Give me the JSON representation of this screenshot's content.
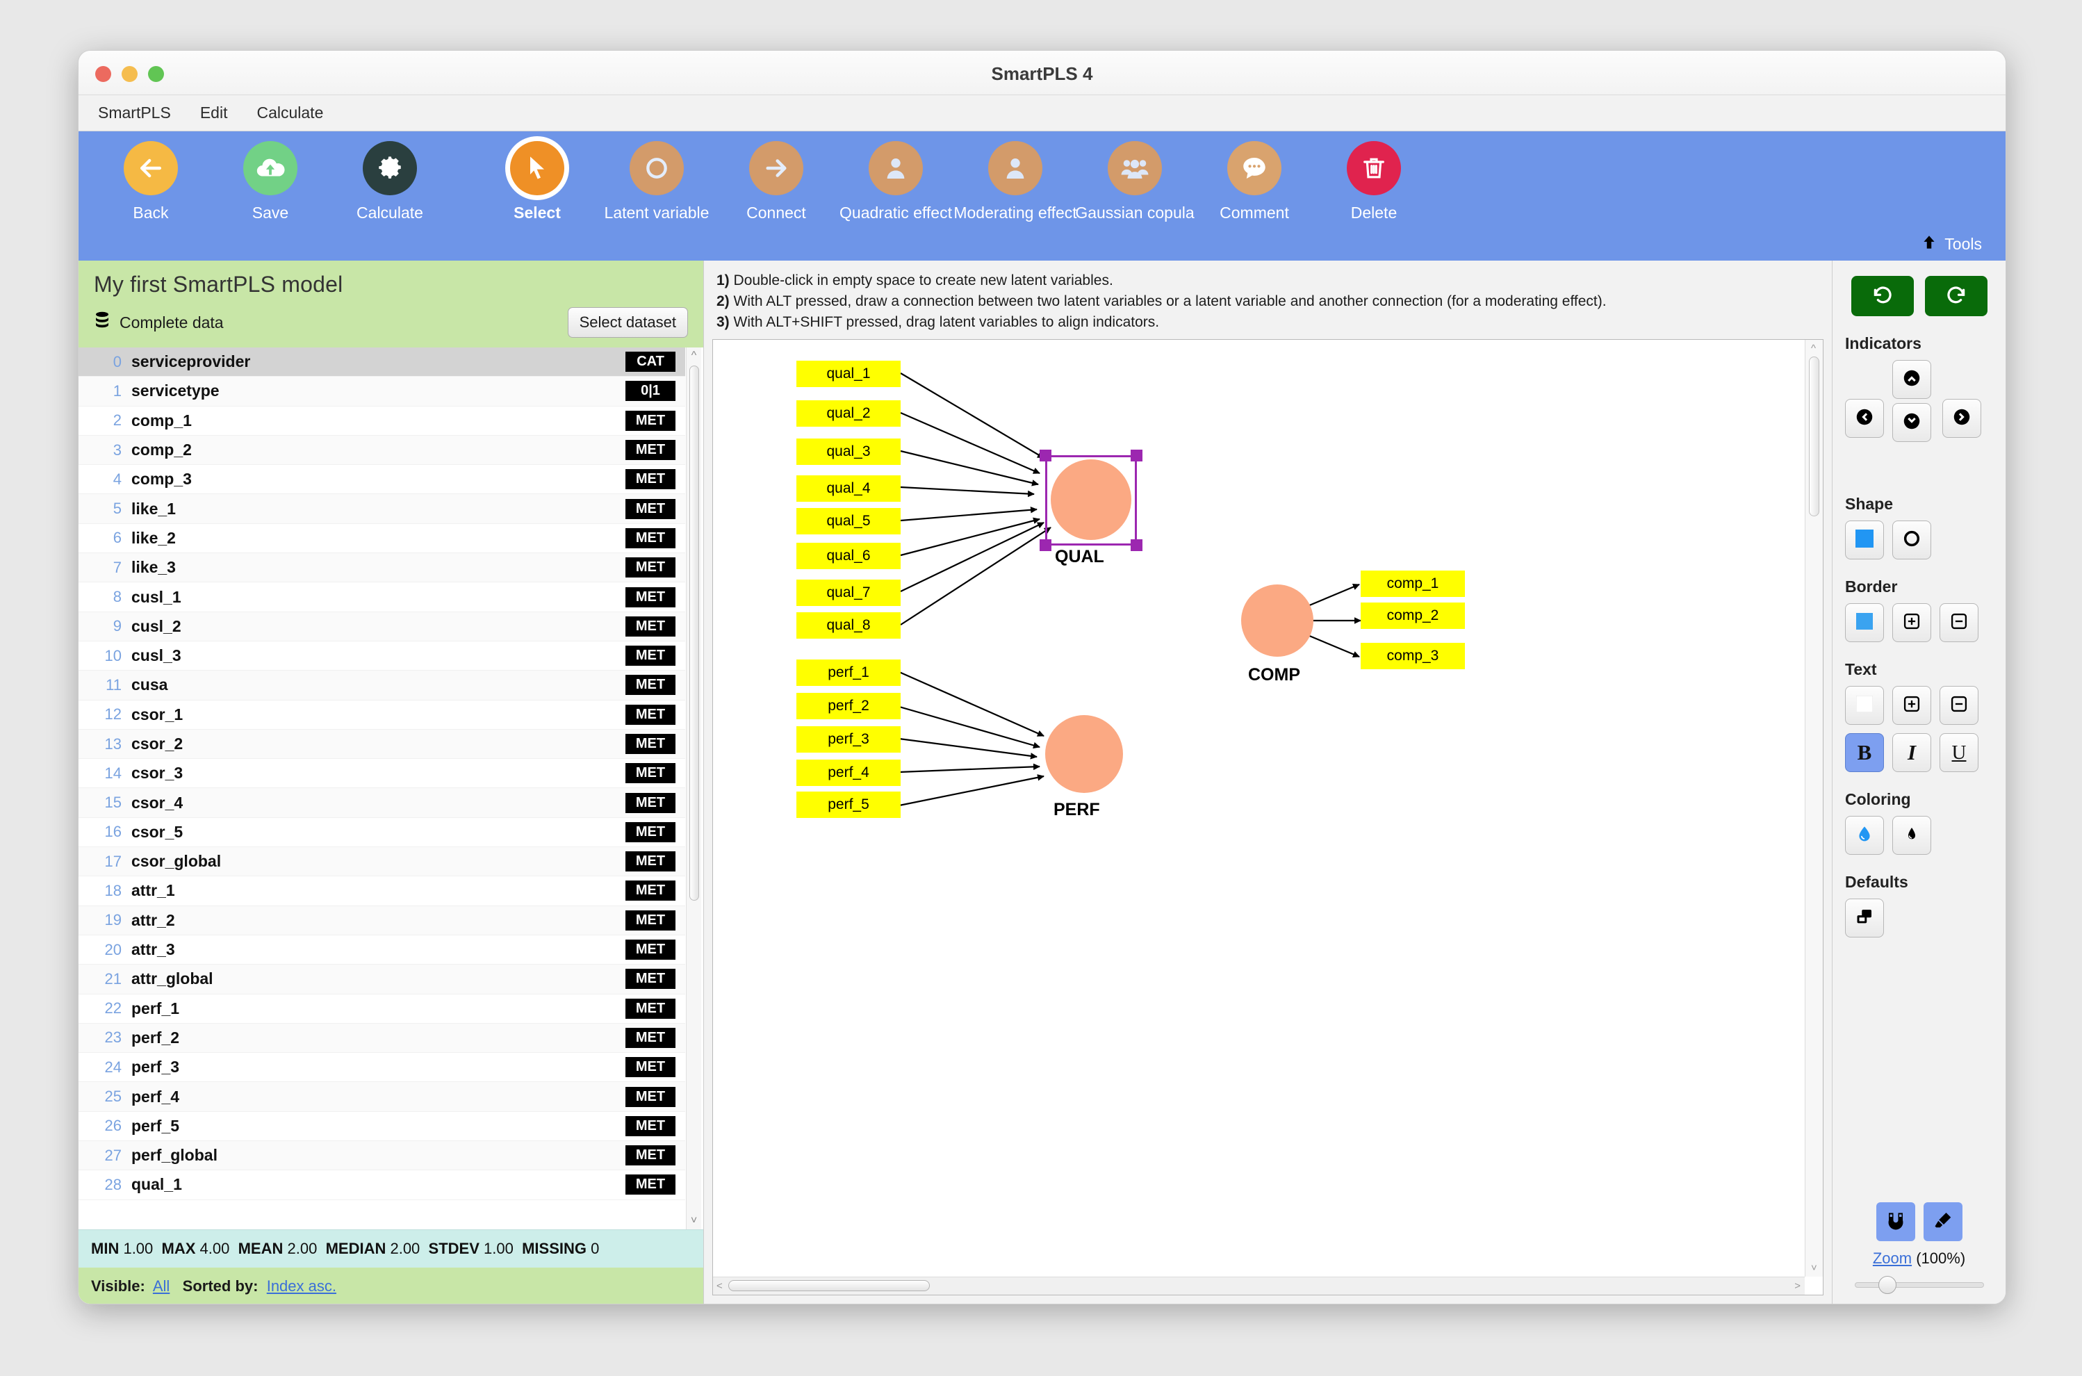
{
  "window": {
    "title": "SmartPLS 4"
  },
  "menubar": {
    "items": [
      "SmartPLS",
      "Edit",
      "Calculate"
    ]
  },
  "ribbon": {
    "tools_label": "Tools",
    "buttons": [
      {
        "label": "Back",
        "icon": "arrow-left-icon",
        "color": "#f5b944",
        "active": false
      },
      {
        "label": "Save",
        "icon": "cloud-upload-icon",
        "color": "#72d186",
        "active": false
      },
      {
        "label": "Calculate",
        "icon": "gear-icon",
        "color": "#2a3f3f",
        "active": false
      },
      {
        "label": "Select",
        "icon": "cursor-arrow-icon",
        "color": "#ef9026",
        "active": true
      },
      {
        "label": "Latent variable",
        "icon": "circle-outline-icon",
        "color": "#d39b6a",
        "active": false
      },
      {
        "label": "Connect",
        "icon": "arrow-right-icon",
        "color": "#d39b6a",
        "active": false
      },
      {
        "label": "Quadratic effect",
        "icon": "person-icon",
        "color": "#d39b6a",
        "active": false
      },
      {
        "label": "Moderating effect",
        "icon": "person-icon",
        "color": "#d39b6a",
        "active": false
      },
      {
        "label": "Gaussian copula",
        "icon": "people-group-icon",
        "color": "#d39b6a",
        "active": false
      },
      {
        "label": "Comment",
        "icon": "speech-bubble-icon",
        "color": "#d9a36e",
        "active": false
      },
      {
        "label": "Delete",
        "icon": "trash-icon",
        "color": "#e0234e",
        "active": false
      }
    ]
  },
  "sidebar": {
    "project_title": "My first SmartPLS model",
    "dataset_label": "Complete data",
    "dataset_icon": "database-icon",
    "select_dataset_button": "Select dataset",
    "variables": [
      {
        "index": "0",
        "name": "serviceprovider",
        "tag": "CAT",
        "selected": true
      },
      {
        "index": "1",
        "name": "servicetype",
        "tag": "0|1",
        "selected": false
      },
      {
        "index": "2",
        "name": "comp_1",
        "tag": "MET",
        "selected": false
      },
      {
        "index": "3",
        "name": "comp_2",
        "tag": "MET",
        "selected": false
      },
      {
        "index": "4",
        "name": "comp_3",
        "tag": "MET",
        "selected": false
      },
      {
        "index": "5",
        "name": "like_1",
        "tag": "MET",
        "selected": false
      },
      {
        "index": "6",
        "name": "like_2",
        "tag": "MET",
        "selected": false
      },
      {
        "index": "7",
        "name": "like_3",
        "tag": "MET",
        "selected": false
      },
      {
        "index": "8",
        "name": "cusl_1",
        "tag": "MET",
        "selected": false
      },
      {
        "index": "9",
        "name": "cusl_2",
        "tag": "MET",
        "selected": false
      },
      {
        "index": "10",
        "name": "cusl_3",
        "tag": "MET",
        "selected": false
      },
      {
        "index": "11",
        "name": "cusa",
        "tag": "MET",
        "selected": false
      },
      {
        "index": "12",
        "name": "csor_1",
        "tag": "MET",
        "selected": false
      },
      {
        "index": "13",
        "name": "csor_2",
        "tag": "MET",
        "selected": false
      },
      {
        "index": "14",
        "name": "csor_3",
        "tag": "MET",
        "selected": false
      },
      {
        "index": "15",
        "name": "csor_4",
        "tag": "MET",
        "selected": false
      },
      {
        "index": "16",
        "name": "csor_5",
        "tag": "MET",
        "selected": false
      },
      {
        "index": "17",
        "name": "csor_global",
        "tag": "MET",
        "selected": false
      },
      {
        "index": "18",
        "name": "attr_1",
        "tag": "MET",
        "selected": false
      },
      {
        "index": "19",
        "name": "attr_2",
        "tag": "MET",
        "selected": false
      },
      {
        "index": "20",
        "name": "attr_3",
        "tag": "MET",
        "selected": false
      },
      {
        "index": "21",
        "name": "attr_global",
        "tag": "MET",
        "selected": false
      },
      {
        "index": "22",
        "name": "perf_1",
        "tag": "MET",
        "selected": false
      },
      {
        "index": "23",
        "name": "perf_2",
        "tag": "MET",
        "selected": false
      },
      {
        "index": "24",
        "name": "perf_3",
        "tag": "MET",
        "selected": false
      },
      {
        "index": "25",
        "name": "perf_4",
        "tag": "MET",
        "selected": false
      },
      {
        "index": "26",
        "name": "perf_5",
        "tag": "MET",
        "selected": false
      },
      {
        "index": "27",
        "name": "perf_global",
        "tag": "MET",
        "selected": false
      },
      {
        "index": "28",
        "name": "qual_1",
        "tag": "MET",
        "selected": false
      }
    ],
    "stats": {
      "min_label": "MIN",
      "min_value": "1.00",
      "max_label": "MAX",
      "max_value": "4.00",
      "mean_label": "MEAN",
      "mean_value": "2.00",
      "median_label": "MEDIAN",
      "median_value": "2.00",
      "stdev_label": "STDEV",
      "stdev_value": "1.00",
      "missing_label": "MISSING",
      "missing_value": "0"
    },
    "footer": {
      "visible_label": "Visible:",
      "visible_value": "All",
      "sorted_label": "Sorted by:",
      "sorted_value": "Index asc."
    }
  },
  "hints": {
    "line1_num": "1)",
    "line1": " Double-click in empty space to create new latent variables.",
    "line2_num": "2)",
    "line2": " With ALT pressed, draw a connection between two latent variables or a latent variable and another connection (for a moderating effect).",
    "line3_num": "3)",
    "line3": " With ALT+SHIFT pressed, drag latent variables to align indicators."
  },
  "model": {
    "indicator_color": "#ffff00",
    "construct_color": "#fba983",
    "selection_color": "#9c27b0",
    "constructs": [
      {
        "name": "QUAL",
        "selected": true,
        "direction": "reflective",
        "indicators": [
          "qual_1",
          "qual_2",
          "qual_3",
          "qual_4",
          "qual_5",
          "qual_6",
          "qual_7",
          "qual_8"
        ]
      },
      {
        "name": "COMP",
        "selected": false,
        "direction": "outgoing",
        "indicators": [
          "comp_1",
          "comp_2",
          "comp_3"
        ]
      },
      {
        "name": "PERF",
        "selected": false,
        "direction": "reflective",
        "indicators": [
          "perf_1",
          "perf_2",
          "perf_3",
          "perf_4",
          "perf_5"
        ]
      }
    ]
  },
  "rightpanel": {
    "undo_icon": "undo-icon",
    "redo_icon": "redo-icon",
    "sections": [
      {
        "title": "Indicators"
      },
      {
        "title": "Shape"
      },
      {
        "title": "Border"
      },
      {
        "title": "Text"
      },
      {
        "title": "Coloring"
      },
      {
        "title": "Defaults"
      }
    ],
    "bold_label": "B",
    "italic_label": "I",
    "underline_label": "U",
    "zoom_link": "Zoom",
    "zoom_value": "(100%)"
  }
}
